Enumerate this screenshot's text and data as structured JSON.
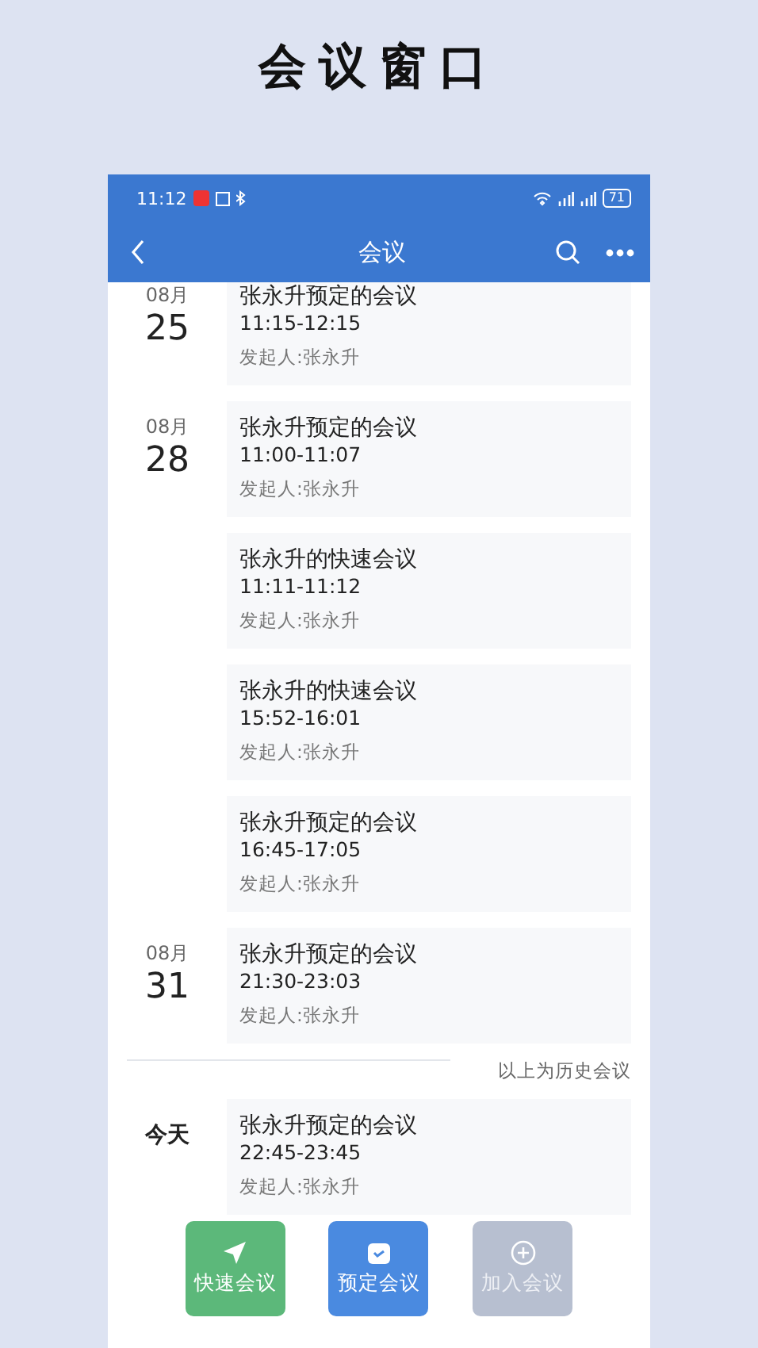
{
  "page_title": "会议窗口",
  "status_bar": {
    "time": "11:12",
    "battery": "71"
  },
  "nav": {
    "title": "会议"
  },
  "groups": [
    {
      "kind": "date",
      "month": "08月",
      "day": "25",
      "meetings": [
        {
          "title": "张永升预定的会议",
          "time": "11:15-12:15",
          "initiator": "发起人:张永升"
        }
      ]
    },
    {
      "kind": "date",
      "month": "08月",
      "day": "28",
      "meetings": [
        {
          "title": "张永升预定的会议",
          "time": "11:00-11:07",
          "initiator": "发起人:张永升"
        },
        {
          "title": "张永升的快速会议",
          "time": "11:11-11:12",
          "initiator": "发起人:张永升"
        },
        {
          "title": "张永升的快速会议",
          "time": "15:52-16:01",
          "initiator": "发起人:张永升"
        },
        {
          "title": "张永升预定的会议",
          "time": "16:45-17:05",
          "initiator": "发起人:张永升"
        }
      ]
    },
    {
      "kind": "date",
      "month": "08月",
      "day": "31",
      "meetings": [
        {
          "title": "张永升预定的会议",
          "time": "21:30-23:03",
          "initiator": "发起人:张永升"
        }
      ]
    },
    {
      "kind": "divider",
      "label": "以上为历史会议"
    },
    {
      "kind": "today",
      "label": "今天",
      "meetings": [
        {
          "title": "张永升预定的会议",
          "time": "22:45-23:45",
          "initiator": "发起人:张永升"
        }
      ]
    }
  ],
  "actions": [
    {
      "kind": "quick",
      "label": "快速会议"
    },
    {
      "kind": "schedule",
      "label": "预定会议"
    },
    {
      "kind": "join",
      "label": "加入会议",
      "disabled": true
    }
  ]
}
